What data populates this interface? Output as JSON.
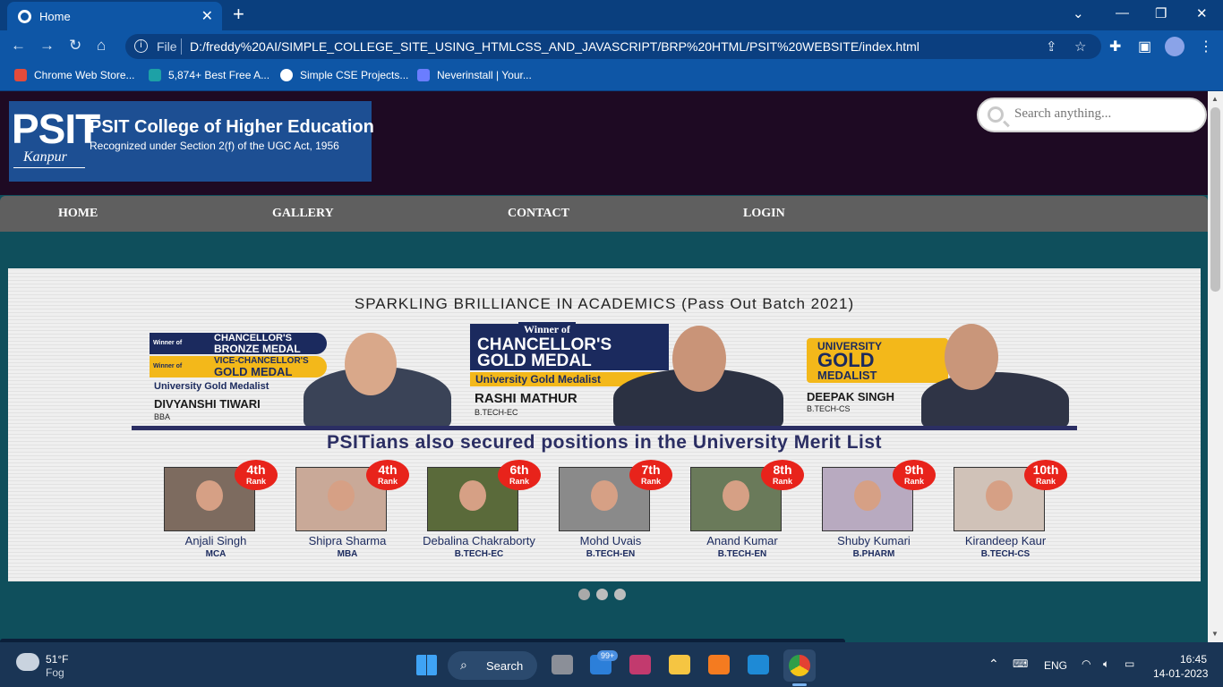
{
  "browser": {
    "tab_title": "Home",
    "tab_close": "✕",
    "new_tab": "+",
    "url_scheme": "File",
    "url": "D:/freddy%20AI/SIMPLE_COLLEGE_SITE_USING_HTMLCSS_AND_JAVASCRIPT/BRP%20HTML/PSIT%20WEBSITE/index.html",
    "bookmarks": [
      "Chrome Web Store...",
      "5,874+ Best Free A...",
      "Simple CSE Projects...",
      "Neverinstall | Your..."
    ]
  },
  "site": {
    "logo_mark": "PSIT",
    "logo_city": "Kanpur",
    "college_name": "PSIT College of Higher Education",
    "recognition": "Recognized under Section 2(f) of the UGC Act, 1956",
    "search_placeholder": "Search anything...",
    "nav": [
      "HOME",
      "GALLERY",
      "CONTACT",
      "LOGIN"
    ]
  },
  "slide": {
    "heading": "SPARKLING BRILLIANCE IN ACADEMICS (Pass Out Batch 2021)",
    "medalists": [
      {
        "tag_small1": "Winner of",
        "tag1": "CHANCELLOR'S",
        "tag1b": "BRONZE MEDAL",
        "tag_small2": "Winner of",
        "tag2": "VICE-CHANCELLOR'S",
        "tag2b": "GOLD MEDAL",
        "title": "University Gold Medalist",
        "name": "DIVYANSHI TIWARI",
        "course": "BBA"
      },
      {
        "tag_small": "Winner of",
        "tag1": "CHANCELLOR'S",
        "tag1b": "GOLD MEDAL",
        "title": "University Gold Medalist",
        "name": "RASHI MATHUR",
        "course": "B.TECH-EC"
      },
      {
        "tag1": "UNIVERSITY",
        "tag1b": "GOLD",
        "tag1c": "MEDALIST",
        "name": "DEEPAK SINGH",
        "course": "B.TECH-CS"
      }
    ],
    "merit_heading": "PSITians also secured positions in the University Merit List",
    "rank_word": "Rank",
    "rankers": [
      {
        "rank": "4th",
        "name": "Anjali Singh",
        "course": "MCA"
      },
      {
        "rank": "4th",
        "name": "Shipra Sharma",
        "course": "MBA"
      },
      {
        "rank": "6th",
        "name": "Debalina Chakraborty",
        "course": "B.TECH-EC"
      },
      {
        "rank": "7th",
        "name": "Mohd Uvais",
        "course": "B.TECH-EN"
      },
      {
        "rank": "8th",
        "name": "Anand Kumar",
        "course": "B.TECH-EN"
      },
      {
        "rank": "9th",
        "name": "Shuby Kumari",
        "course": "B.PHARM"
      },
      {
        "rank": "10th",
        "name": "Kirandeep Kaur",
        "course": "B.TECH-CS"
      }
    ]
  },
  "taskbar": {
    "weather_temp": "51°F",
    "weather_desc": "Fog",
    "search_label": "Search",
    "mail_badge": "99+",
    "lang": "ENG",
    "time": "16:45",
    "date": "14-01-2023"
  }
}
